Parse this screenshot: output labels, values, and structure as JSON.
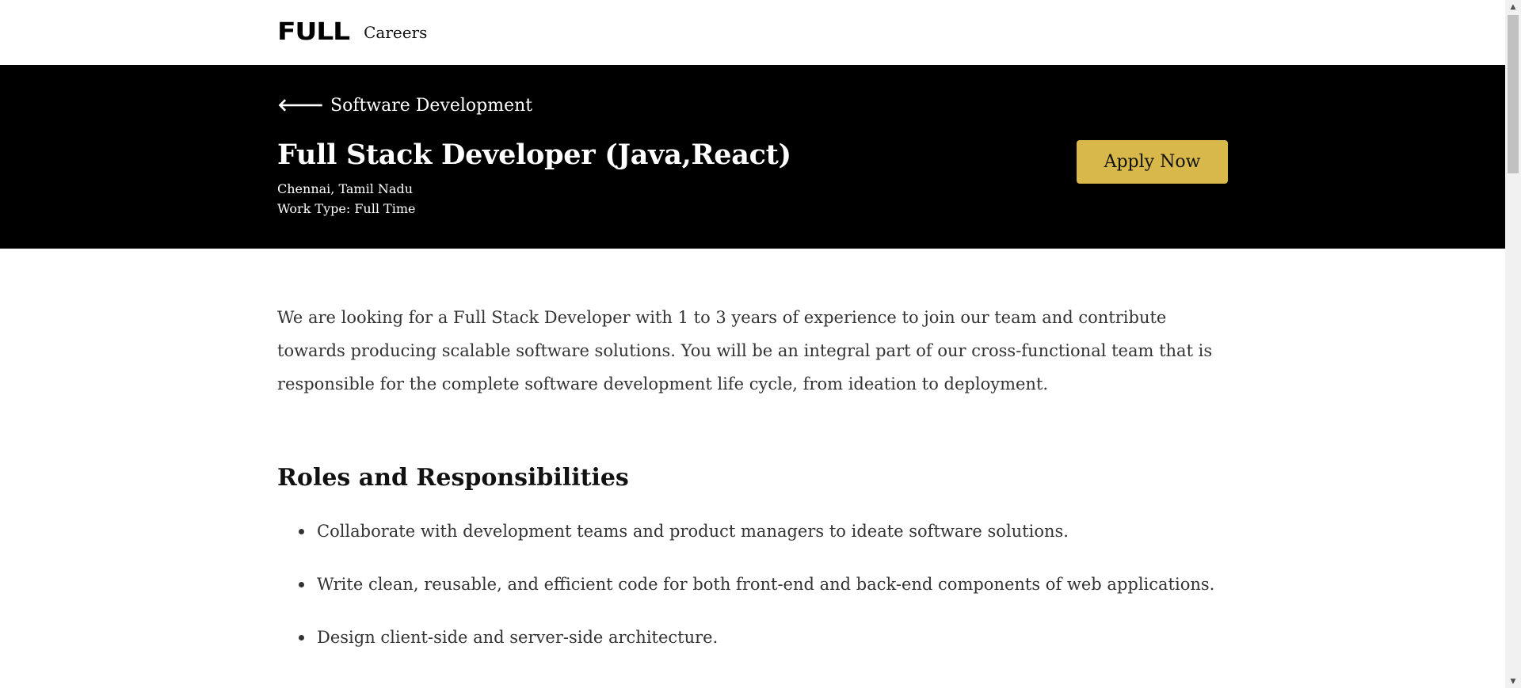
{
  "nav": {
    "logo": "FULL",
    "careers_label": "Careers"
  },
  "hero": {
    "back_label": "Software Development",
    "title": "Full Stack Developer (Java,React)",
    "location": "Chennai, Tamil Nadu",
    "work_type": "Work Type: Full Time",
    "apply_label": "Apply Now",
    "apply_color": "#d8b84a",
    "background": "#000000"
  },
  "content": {
    "intro": "We are looking for a Full Stack Developer with 1 to 3 years of experience to join our team and contribute towards producing scalable software solutions. You will be an integral part of our cross-functional team that is responsible for the complete software development life cycle, from ideation to deployment.",
    "roles_heading": "Roles and Responsibilities",
    "responsibilities": [
      "Collaborate with development teams and product managers to ideate software solutions.",
      "Write clean, reusable, and efficient code for both front-end and back-end components of web applications.",
      "Design client-side and server-side architecture."
    ]
  },
  "icons": {
    "back": "arrow-left-icon"
  }
}
